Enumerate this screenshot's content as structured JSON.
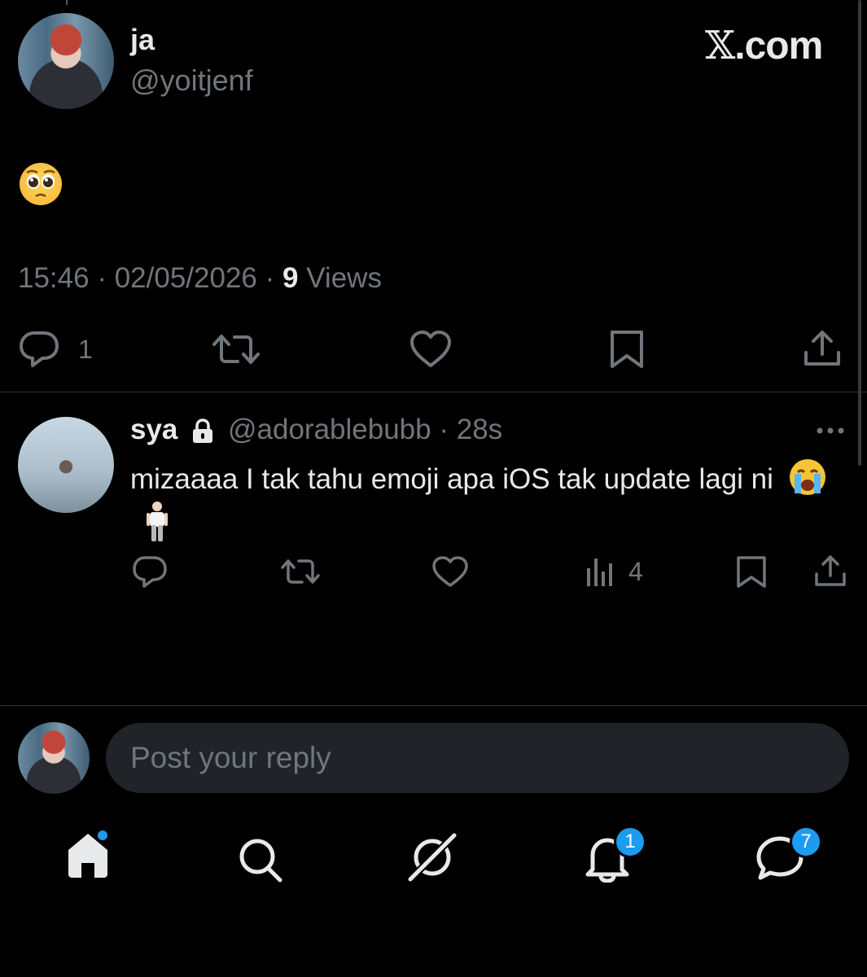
{
  "post": {
    "author_name": "ja",
    "author_handle": "@yoitjenf",
    "brand": "X.com",
    "emoji": "pleading-face",
    "time": "15:46",
    "date": "02/05/2026",
    "views_count": "9",
    "views_label": "Views",
    "sep": "·",
    "reply_count": "1"
  },
  "reply": {
    "author_name": "sya",
    "author_handle": "@adorablebubb",
    "age": "28s",
    "sep": "·",
    "text": "mizaaaa I tak tahu emoji apa iOS tak update lagi ni",
    "emojis": [
      "loudly-crying-face",
      "person-standing"
    ],
    "views_count": "4"
  },
  "composer": {
    "placeholder": "Post your reply"
  },
  "nav": {
    "notifications_badge": "1",
    "messages_badge": "7"
  },
  "colors": {
    "accent": "#1d9bf0",
    "muted": "#71767b",
    "text": "#e7e9ea",
    "background": "#000000"
  }
}
